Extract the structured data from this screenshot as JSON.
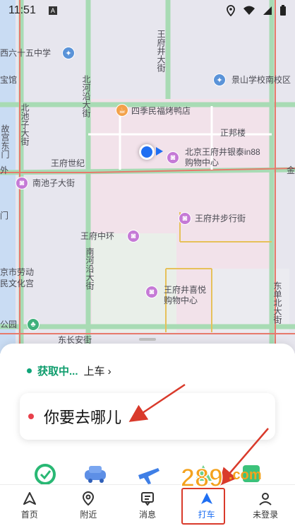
{
  "status_bar": {
    "time": "11:51"
  },
  "map": {
    "labels": [
      {
        "key": "l1",
        "text": "西六十五中学"
      },
      {
        "key": "l2",
        "text": "宝馆"
      },
      {
        "key": "l3",
        "text": "景山学校南校区"
      },
      {
        "key": "l4",
        "text": "四季民福烤鸭店"
      },
      {
        "key": "l5",
        "text": "正邦楼"
      },
      {
        "key": "l6",
        "text": "北京王府井银泰in88"
      },
      {
        "key": "l7",
        "text": "购物中心"
      },
      {
        "key": "l8",
        "text": "王府世纪"
      },
      {
        "key": "l9",
        "text": "南池子大街"
      },
      {
        "key": "l10",
        "text": "王府井步行街"
      },
      {
        "key": "l11",
        "text": "王府中环"
      },
      {
        "key": "l12",
        "text": "王府井喜悦"
      },
      {
        "key": "l13",
        "text": "购物中心"
      },
      {
        "key": "l14",
        "text": "京市劳动"
      },
      {
        "key": "l15",
        "text": "民文化宫"
      },
      {
        "key": "l16",
        "text": "公园"
      },
      {
        "key": "l17",
        "text": "东长安街"
      },
      {
        "key": "l18",
        "text": "金"
      },
      {
        "key": "l19",
        "text": "门"
      },
      {
        "key": "l20",
        "text": "外"
      }
    ],
    "vertical_labels": {
      "wangfujing": "王府井大街",
      "beiheyan": "北河沿大街",
      "beichizi": "北池子大街",
      "nanheyan": "南河沿大街",
      "dongdanbei": "东单北大街",
      "gu": "故宫东门"
    }
  },
  "sheet": {
    "pickup_status": "获取中...",
    "pickup_action": "上车 ›",
    "destination_placeholder": "你要去哪儿"
  },
  "tabs": [
    {
      "label": "首页",
      "icon": "home-icon"
    },
    {
      "label": "附近",
      "icon": "location-pin-icon"
    },
    {
      "label": "消息",
      "icon": "message-icon"
    },
    {
      "label": "打车",
      "icon": "taxi-icon"
    },
    {
      "label": "未登录",
      "icon": "user-icon"
    }
  ],
  "colors": {
    "accent": "#1f6ff2",
    "green": "#10a579",
    "red": "#e8404b",
    "annotation": "#d93a2b"
  }
}
